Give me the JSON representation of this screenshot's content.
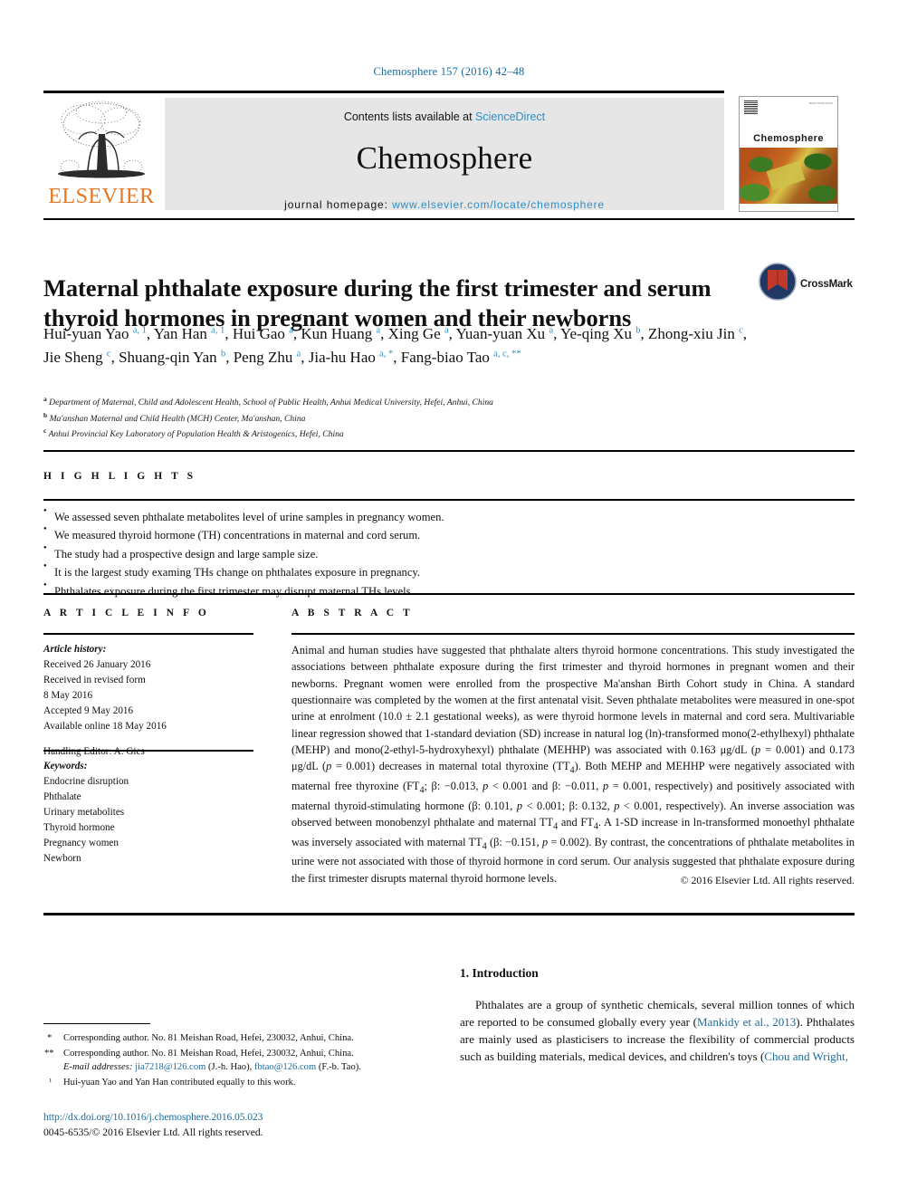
{
  "running_head": "Chemosphere 157 (2016) 42–48",
  "masthead": {
    "publisher_name": "ELSEVIER",
    "contents_prefix": "Contents lists available at ",
    "contents_link": "ScienceDirect",
    "journal_name": "Chemosphere",
    "homepage_prefix": "journal homepage: ",
    "homepage_url": "www.elsevier.com/locate/chemosphere",
    "cover_title": "Chemosphere"
  },
  "article": {
    "title": "Maternal phthalate exposure during the first trimester and serum thyroid hormones in pregnant women and their newborns",
    "crossmark_label": "CrossMark",
    "authors_html": "Hui-yuan Yao <sup>a, 1</sup>, Yan Han <sup>a, 1</sup>, Hui Gao <sup>a</sup>, Kun Huang <sup>a</sup>, Xing Ge <sup>a</sup>, Yuan-yuan Xu <sup>a</sup>, Ye-qing Xu <sup>b</sup>, Zhong-xiu Jin <sup>c</sup>, Jie Sheng <sup>c</sup>, Shuang-qin Yan <sup>b</sup>, Peng Zhu <sup>a</sup>, Jia-hu Hao <sup>a, *</sup>, Fang-biao Tao <sup>a, c, **</sup>",
    "affiliations": [
      {
        "mark": "a",
        "text": "Department of Maternal, Child and Adolescent Health, School of Public Health, Anhui Medical University, Hefei, Anhui, China"
      },
      {
        "mark": "b",
        "text": "Ma'anshan Maternal and Child Health (MCH) Center, Ma'anshan, China"
      },
      {
        "mark": "c",
        "text": "Anhui Provincial Key Laboratory of Population Health & Aristogenics, Hefei, China"
      }
    ]
  },
  "highlights": {
    "heading": "H I G H L I G H T S",
    "items": [
      "We assessed seven phthalate metabolites level of urine samples in pregnancy women.",
      "We measured thyroid hormone (TH) concentrations in maternal and cord serum.",
      "The study had a prospective design and large sample size.",
      "It is the largest study examing THs change on phthalates exposure in pregnancy.",
      "Phthalates exposure during the first trimester may disrupt maternal THs levels."
    ]
  },
  "article_info": {
    "heading": "A R T I C L E   I N F O",
    "history_label": "Article history:",
    "history": [
      "Received 26 January 2016",
      "Received in revised form",
      "8 May 2016",
      "Accepted 9 May 2016",
      "Available online 18 May 2016"
    ],
    "handling_editor": "Handling Editor: A. Gies",
    "keywords_label": "Keywords:",
    "keywords": [
      "Endocrine disruption",
      "Phthalate",
      "Urinary metabolites",
      "Thyroid hormone",
      "Pregnancy women",
      "Newborn"
    ]
  },
  "abstract": {
    "heading": "A B S T R A C T",
    "body_html": "Animal and human studies have suggested that phthalate alters thyroid hormone concentrations. This study investigated the associations between phthalate exposure during the first trimester and thyroid hormones in pregnant women and their newborns. Pregnant women were enrolled from the prospective Ma'anshan Birth Cohort study in China. A standard questionnaire was completed by the women at the first antenatal visit. Seven phthalate metabolites were measured in one-spot urine at enrolment (10.0 &plusmn; 2.1 gestational weeks), as were thyroid hormone levels in maternal and cord sera. Multivariable linear regression showed that 1-standard deviation (SD) increase in natural log (ln)-transformed mono(2-ethylhexyl) phthalate (MEHP) and mono(2-ethyl-5-hydroxyhexyl) phthalate (MEHHP) was associated with 0.163 &mu;g/dL (<i>p</i> = 0.001) and 0.173 &mu;g/dL (<i>p</i> = 0.001) decreases in maternal total thyroxine (TT<sub>4</sub>). Both MEHP and MEHHP were negatively associated with maternal free thyroxine (FT<sub>4</sub>; &beta;: &minus;0.013, <i>p</i> &lt; 0.001 and &beta;: &minus;0.011, <i>p</i> = 0.001, respectively) and positively associated with maternal thyroid-stimulating hormone (&beta;: 0.101, <i>p</i> &lt; 0.001; &beta;: 0.132, <i>p</i> &lt; 0.001, respectively). An inverse association was observed between monobenzyl phthalate and maternal TT<sub>4</sub> and FT<sub>4</sub>. A 1-SD increase in ln-transformed monoethyl phthalate was inversely associated with maternal TT<sub>4</sub> (&beta;: &minus;0.151, <i>p</i> = 0.002). By contrast, the concentrations of phthalate metabolites in urine were not associated with those of thyroid hormone in cord serum. Our analysis suggested that phthalate exposure during the first trimester disrupts maternal thyroid hormone levels.",
    "copyright": "© 2016 Elsevier Ltd. All rights reserved."
  },
  "introduction": {
    "heading": "1.  Introduction",
    "paragraph_html": "Phthalates are a group of synthetic chemicals, several million tonnes of which are reported to be consumed globally every year (<span class=\"cite\">Mankidy et al., 2013</span>). Phthalates are mainly used as plasticisers to increase the flexibility of commercial products such as building materials, medical devices, and children's toys (<span class=\"cite\">Chou and Wright,</span>"
  },
  "footnotes": [
    {
      "mark": "*",
      "text_html": "Corresponding author. No. 81 Meishan Road, Hefei, 230032, Anhui, China."
    },
    {
      "mark": "**",
      "text_html": "Corresponding author. No. 81 Meishan Road, Hefei, 230032, Anhui, China.<br><span class=\"em-label\">E-mail addresses:</span> <span class=\"mail\">jia7218@126.com</span> (J.-h. Hao), <span class=\"mail\">fbtao@126.com</span> (F.-b. Tao)."
    },
    {
      "mark": "1",
      "text_html": "Hui-yuan Yao and Yan Han contributed equally to this work."
    }
  ],
  "doi": {
    "url": "http://dx.doi.org/10.1016/j.chemosphere.2016.05.023",
    "issn_line": "0045-6535/© 2016 Elsevier Ltd. All rights reserved."
  },
  "colors": {
    "link_blue": "#1a6ba0",
    "science_direct_blue": "#2f8fc4",
    "elsevier_orange": "#e87722",
    "band_gray": "#e6e6e6",
    "crossmark_red": "#c0392b",
    "crossmark_navy": "#1f3864"
  }
}
